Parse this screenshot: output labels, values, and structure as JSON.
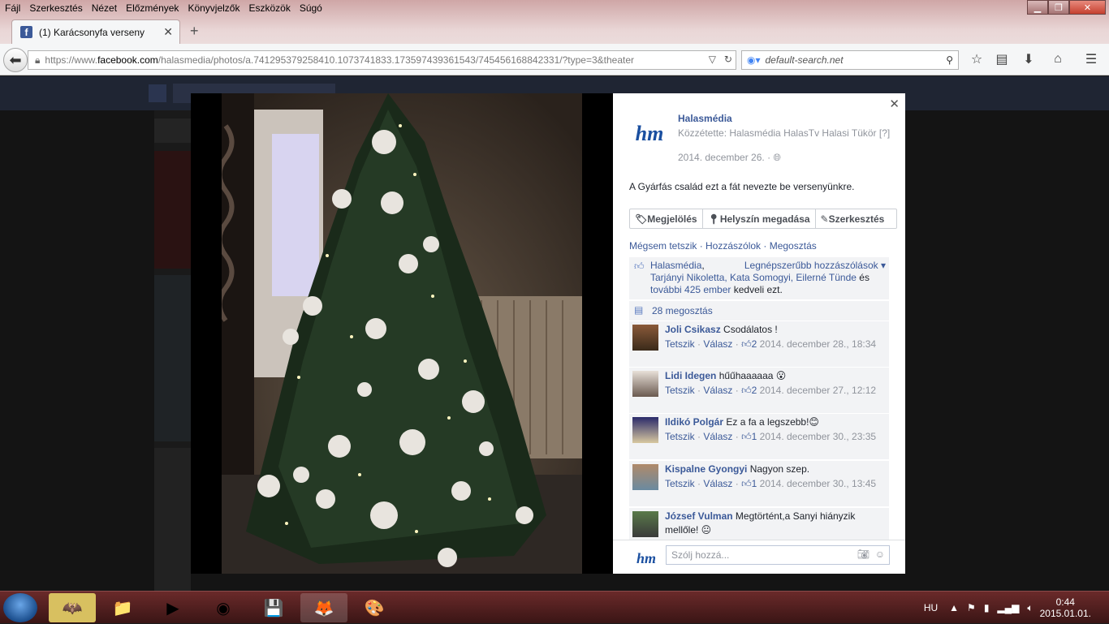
{
  "browser": {
    "menu": [
      "Fájl",
      "Szerkesztés",
      "Nézet",
      "Előzmények",
      "Könyvjelzők",
      "Eszközök",
      "Súgó"
    ],
    "tab_title": "(1) Karácsonyfa verseny",
    "url_prefix": "https://www.",
    "url_domain": "facebook.com",
    "url_rest": "/halasmedia/photos/a.741295379258410.1073741833.173597439361543/745456168842331/?type=3&theater",
    "search_placeholder": "default-search.net"
  },
  "post": {
    "page_name": "Halasmédia",
    "posted_by": "Közzétette: Halasmédia HalasTv Halasi Tükör [?]",
    "date": "2014. december 26. · ",
    "caption": "A Gyárfás család ezt a fát nevezte be versenyünkre.",
    "actions": {
      "tag": "Megjelölés",
      "location": "Helyszín megadása",
      "edit": "Szerkesztés"
    },
    "links": "Mégsem tetszik · Hozzászólok · Megosztás",
    "likes": {
      "name1": "Halasmédia",
      "sort": "Legnépszerűbb hozzászólások",
      "names": "Tarjányi Nikoletta, Kata Somogyi, Eilerné Tünde",
      "and": "és",
      "more": "további 425 ember",
      "suffix": "kedveli ezt."
    },
    "shares": "28 megosztás"
  },
  "comments": [
    {
      "name": "Joli Csikasz",
      "text": "Csodálatos !",
      "like": "Tetszik",
      "reply": "Válasz",
      "count": "2",
      "date": "2014. december 28., 18:34"
    },
    {
      "name": "Lidi Idegen",
      "text": "hűűhaaaaaa 😮",
      "like": "Tetszik",
      "reply": "Válasz",
      "count": "2",
      "date": "2014. december 27., 12:12"
    },
    {
      "name": "Ildikó Polgár",
      "text": "Ez a fa a legszebb!😊",
      "like": "Tetszik",
      "reply": "Válasz",
      "count": "1",
      "date": "2014. december 30., 23:35"
    },
    {
      "name": "Kispalne Gyongyi",
      "text": "Nagyon szep.",
      "like": "Tetszik",
      "reply": "Válasz",
      "count": "1",
      "date": "2014. december 30., 13:45"
    },
    {
      "name": "József Vulman",
      "text": "Megtörtént,a Sanyi hiányzik mellőle! 😐",
      "like": "",
      "reply": "",
      "count": "",
      "date": ""
    }
  ],
  "comment_placeholder": "Szólj hozzá...",
  "taskbar": {
    "lang": "HU",
    "time": "0:44",
    "date": "2015.01.01."
  },
  "colors": {
    "fb_blue": "#3b5998",
    "grey_text": "#90949c",
    "panel_bg": "#f2f3f5"
  }
}
